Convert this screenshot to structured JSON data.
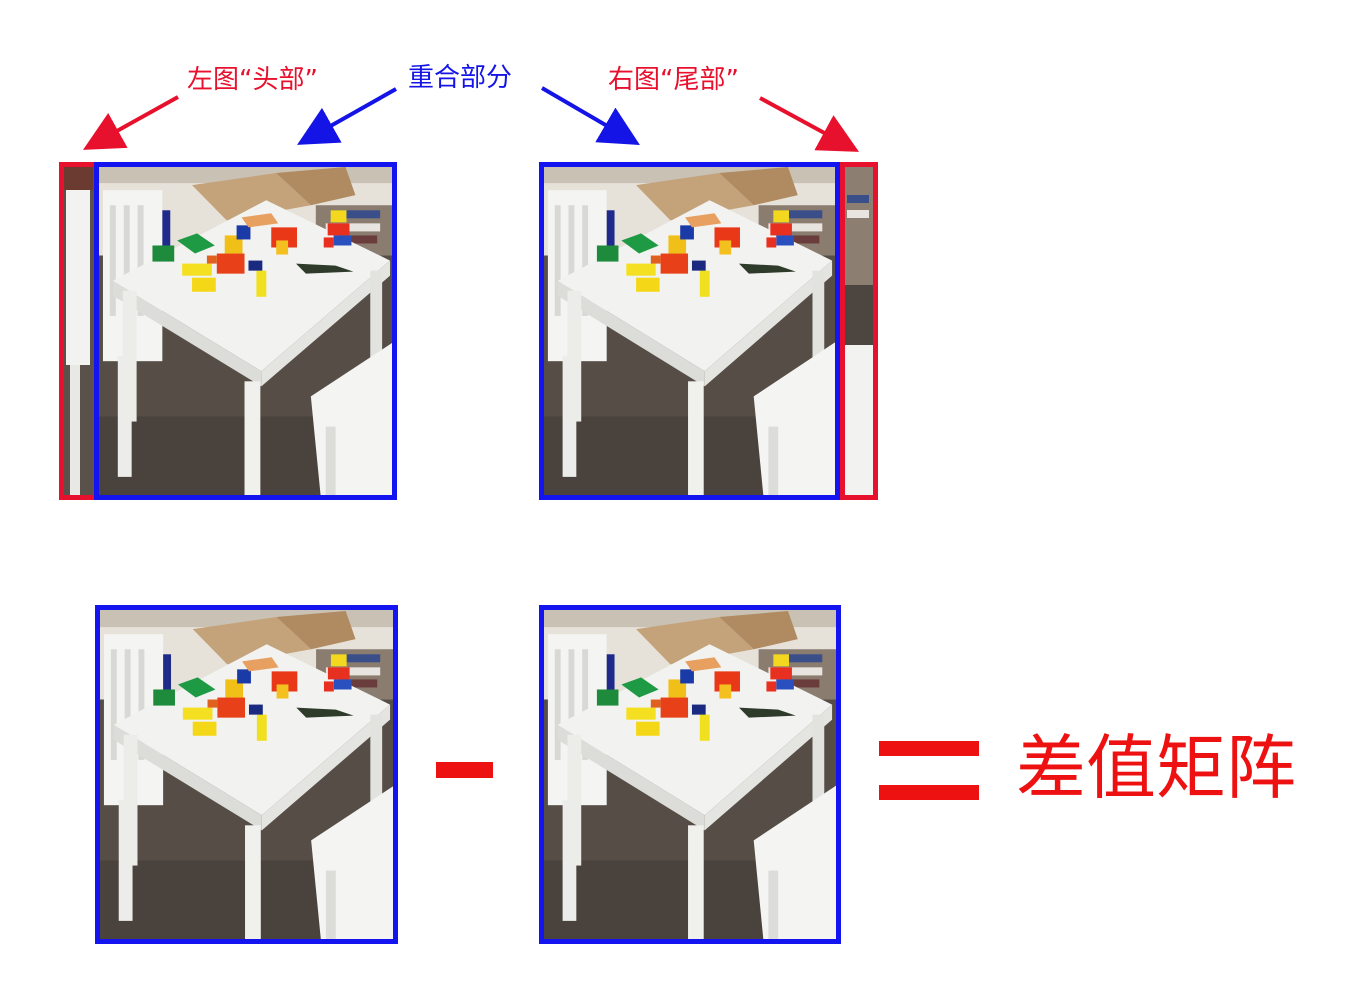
{
  "labels": {
    "left_head": "左图“头部”",
    "overlap": "重合部分",
    "right_tail": "右图“尾部”"
  },
  "result": {
    "text": "差值矩阵"
  },
  "colors": {
    "red": "#e8112d",
    "blue": "#1414f0"
  }
}
